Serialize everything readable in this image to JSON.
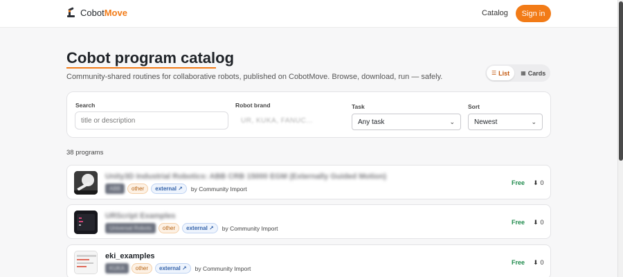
{
  "header": {
    "brand_plain": "Cobot",
    "brand_accent": "Move",
    "nav_catalog": "Catalog",
    "signin": "Sign in"
  },
  "page": {
    "title": "Cobot program catalog",
    "subtitle": "Community-shared routines for collaborative robots, published on CobotMove. Browse, download, run — safely."
  },
  "view_toggle": {
    "list": "List",
    "cards": "Cards",
    "active": "List"
  },
  "filters": {
    "search_label": "Search",
    "search_placeholder": "title or description",
    "brand_label": "Robot brand",
    "brand_placeholder": "UR, KUKA, FANUC...",
    "task_label": "Task",
    "task_value": "Any task",
    "sort_label": "Sort",
    "sort_value": "Newest"
  },
  "count": "38 programs",
  "programs": [
    {
      "title": "Unity3D Industrial Robotics: ABB CRB 15000 EGM (Externally Guided Motion)",
      "brand": "ABB",
      "category": "other",
      "source": "external ↗",
      "author": "by Community Import",
      "price": "Free",
      "downloads": "0",
      "blurred": true
    },
    {
      "title": "URScript Examples",
      "brand": "Universal Robots",
      "category": "other",
      "source": "external ↗",
      "author": "by Community Import",
      "price": "Free",
      "downloads": "0",
      "blurred": true
    },
    {
      "title": "eki_examples",
      "brand": "KUKA",
      "category": "other",
      "source": "external ↗",
      "author": "by Community Import",
      "price": "Free",
      "downloads": "0",
      "blurred": false
    }
  ],
  "colors": {
    "accent": "#f27b17",
    "free": "#1f8a4c",
    "external": "#2f5fa8"
  }
}
